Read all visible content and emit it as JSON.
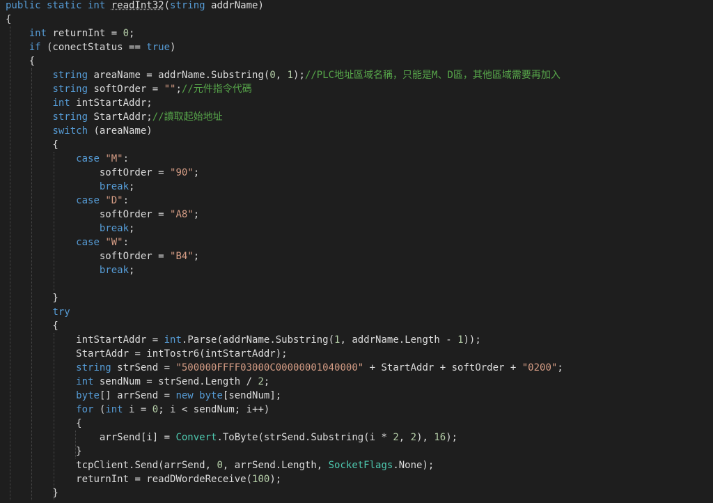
{
  "colors": {
    "background": "#1e1e1e",
    "keyword": "#569cd6",
    "type": "#4ec9b0",
    "string": "#d69d85",
    "number": "#b5cea8",
    "comment": "#57a64a",
    "identifier": "#dcdcdc",
    "indent_guide": "#4a4a4a"
  },
  "code_lines": [
    [
      [
        "kw",
        "public static int "
      ],
      [
        "method",
        "readInt32"
      ],
      [
        "p",
        "("
      ],
      [
        "kw",
        "string"
      ],
      [
        "id",
        " addrName)"
      ]
    ],
    [
      [
        "p",
        "{"
      ]
    ],
    [
      [
        "p",
        "    "
      ],
      [
        "kw",
        "int"
      ],
      [
        "id",
        " returnInt = "
      ],
      [
        "num",
        "0"
      ],
      [
        "p",
        ";"
      ]
    ],
    [
      [
        "p",
        "    "
      ],
      [
        "kw",
        "if"
      ],
      [
        "id",
        " (conectStatus == "
      ],
      [
        "kw",
        "true"
      ],
      [
        "p",
        ")"
      ]
    ],
    [
      [
        "p",
        "    {"
      ]
    ],
    [
      [
        "p",
        "        "
      ],
      [
        "kw",
        "string"
      ],
      [
        "id",
        " areaName = addrName.Substring("
      ],
      [
        "num",
        "0"
      ],
      [
        "p",
        ", "
      ],
      [
        "num",
        "1"
      ],
      [
        "p",
        ");"
      ],
      [
        "cm",
        "//PLC地址區域名稱，只能是M、D區，其他區域需要再加入"
      ]
    ],
    [
      [
        "p",
        "        "
      ],
      [
        "kw",
        "string"
      ],
      [
        "id",
        " softOrder = "
      ],
      [
        "str",
        "\"\""
      ],
      [
        "p",
        ";"
      ],
      [
        "cm",
        "//元件指令代碼"
      ]
    ],
    [
      [
        "p",
        "        "
      ],
      [
        "kw",
        "int"
      ],
      [
        "id",
        " intStartAddr;"
      ]
    ],
    [
      [
        "p",
        "        "
      ],
      [
        "kw",
        "string"
      ],
      [
        "id",
        " StartAddr;"
      ],
      [
        "cm",
        "//讀取起始地址"
      ]
    ],
    [
      [
        "p",
        "        "
      ],
      [
        "kw",
        "switch"
      ],
      [
        "id",
        " (areaName)"
      ]
    ],
    [
      [
        "p",
        "        {"
      ]
    ],
    [
      [
        "p",
        "            "
      ],
      [
        "kw",
        "case"
      ],
      [
        "p",
        " "
      ],
      [
        "str",
        "\"M\""
      ],
      [
        "p",
        ":"
      ]
    ],
    [
      [
        "p",
        "                "
      ],
      [
        "id",
        "softOrder = "
      ],
      [
        "str",
        "\"90\""
      ],
      [
        "p",
        ";"
      ]
    ],
    [
      [
        "p",
        "                "
      ],
      [
        "kw",
        "break"
      ],
      [
        "p",
        ";"
      ]
    ],
    [
      [
        "p",
        "            "
      ],
      [
        "kw",
        "case"
      ],
      [
        "p",
        " "
      ],
      [
        "str",
        "\"D\""
      ],
      [
        "p",
        ":"
      ]
    ],
    [
      [
        "p",
        "                "
      ],
      [
        "id",
        "softOrder = "
      ],
      [
        "str",
        "\"A8\""
      ],
      [
        "p",
        ";"
      ]
    ],
    [
      [
        "p",
        "                "
      ],
      [
        "kw",
        "break"
      ],
      [
        "p",
        ";"
      ]
    ],
    [
      [
        "p",
        "            "
      ],
      [
        "kw",
        "case"
      ],
      [
        "p",
        " "
      ],
      [
        "str",
        "\"W\""
      ],
      [
        "p",
        ":"
      ]
    ],
    [
      [
        "p",
        "                "
      ],
      [
        "id",
        "softOrder = "
      ],
      [
        "str",
        "\"B4\""
      ],
      [
        "p",
        ";"
      ]
    ],
    [
      [
        "p",
        "                "
      ],
      [
        "kw",
        "break"
      ],
      [
        "p",
        ";"
      ]
    ],
    [],
    [
      [
        "p",
        "        }"
      ]
    ],
    [
      [
        "p",
        "        "
      ],
      [
        "kw",
        "try"
      ]
    ],
    [
      [
        "p",
        "        {"
      ]
    ],
    [
      [
        "p",
        "            "
      ],
      [
        "id",
        "intStartAddr = "
      ],
      [
        "kw",
        "int"
      ],
      [
        "id",
        ".Parse(addrName.Substring("
      ],
      [
        "num",
        "1"
      ],
      [
        "p",
        ", "
      ],
      [
        "id",
        "addrName.Length - "
      ],
      [
        "num",
        "1"
      ],
      [
        "p",
        "));"
      ]
    ],
    [
      [
        "p",
        "            "
      ],
      [
        "id",
        "StartAddr = intTostr6(intStartAddr);"
      ]
    ],
    [
      [
        "p",
        "            "
      ],
      [
        "kw",
        "string"
      ],
      [
        "id",
        " strSend = "
      ],
      [
        "str",
        "\"500000FFFF03000C00000001040000\""
      ],
      [
        "id",
        " + StartAddr + softOrder + "
      ],
      [
        "str",
        "\"0200\""
      ],
      [
        "p",
        ";"
      ]
    ],
    [
      [
        "p",
        "            "
      ],
      [
        "kw",
        "int"
      ],
      [
        "id",
        " sendNum = strSend.Length / "
      ],
      [
        "num",
        "2"
      ],
      [
        "p",
        ";"
      ]
    ],
    [
      [
        "p",
        "            "
      ],
      [
        "kw",
        "byte"
      ],
      [
        "id",
        "[] arrSend = "
      ],
      [
        "kw",
        "new byte"
      ],
      [
        "id",
        "[sendNum];"
      ]
    ],
    [
      [
        "p",
        "            "
      ],
      [
        "kw",
        "for"
      ],
      [
        "id",
        " ("
      ],
      [
        "kw",
        "int"
      ],
      [
        "id",
        " i = "
      ],
      [
        "num",
        "0"
      ],
      [
        "id",
        "; i < sendNum; i++)"
      ]
    ],
    [
      [
        "p",
        "            {"
      ]
    ],
    [
      [
        "p",
        "                "
      ],
      [
        "id",
        "arrSend[i] = "
      ],
      [
        "type",
        "Convert"
      ],
      [
        "id",
        ".ToByte(strSend.Substring(i * "
      ],
      [
        "num",
        "2"
      ],
      [
        "p",
        ", "
      ],
      [
        "num",
        "2"
      ],
      [
        "p",
        "), "
      ],
      [
        "num",
        "16"
      ],
      [
        "p",
        ");"
      ]
    ],
    [
      [
        "p",
        "            }"
      ]
    ],
    [
      [
        "p",
        "            "
      ],
      [
        "id",
        "tcpClient.Send(arrSend, "
      ],
      [
        "num",
        "0"
      ],
      [
        "id",
        ", arrSend.Length, "
      ],
      [
        "type",
        "SocketFlags"
      ],
      [
        "id",
        ".None);"
      ]
    ],
    [
      [
        "p",
        "            "
      ],
      [
        "id",
        "returnInt = readDWordeReceive("
      ],
      [
        "num",
        "100"
      ],
      [
        "p",
        ");"
      ]
    ],
    [
      [
        "p",
        "        }"
      ]
    ]
  ]
}
